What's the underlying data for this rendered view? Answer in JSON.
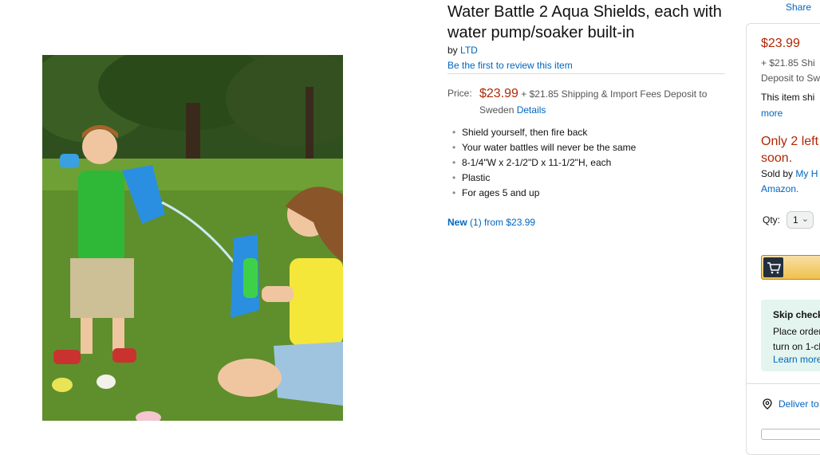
{
  "product": {
    "title": "Water Battle 2 Aqua Shields, each with water pump/soaker built-in",
    "by_prefix": "by",
    "brand": "LTD",
    "review_link": "Be the first to review this item",
    "price_label": "Price:",
    "price": "$23.99",
    "shipping_text": "+ $21.85 Shipping & Import Fees Deposit to Sweden",
    "details_link": "Details",
    "bullets": [
      "Shield yourself, then fire back",
      "Your water battles will never be the same",
      "8-1/4\"W x 2-1/2\"D x 11-1/2\"H, each",
      "Plastic",
      "For ages 5 and up"
    ],
    "new_label": "New",
    "new_offers": "(1) from $23.99"
  },
  "share": "Share",
  "buybox": {
    "price": "$23.99",
    "ship_line1": "+ $21.85 Shi",
    "ship_line2": "Deposit to Sw",
    "ships_text": "This item shi",
    "more_link": "more",
    "stock_line1": "Only 2 left",
    "stock_line2": "soon.",
    "sold_by_prefix": "Sold by",
    "seller": "My H",
    "amazon": "Amazon.",
    "qty_label": "Qty:",
    "qty_value": "1",
    "skip_title": "Skip check",
    "skip_line1": "Place order",
    "skip_line2": "turn on 1-cl",
    "learn_more": "Learn more",
    "deliver": "Deliver to",
    "accent_color": "#B12704",
    "link_color": "#0066c0"
  }
}
